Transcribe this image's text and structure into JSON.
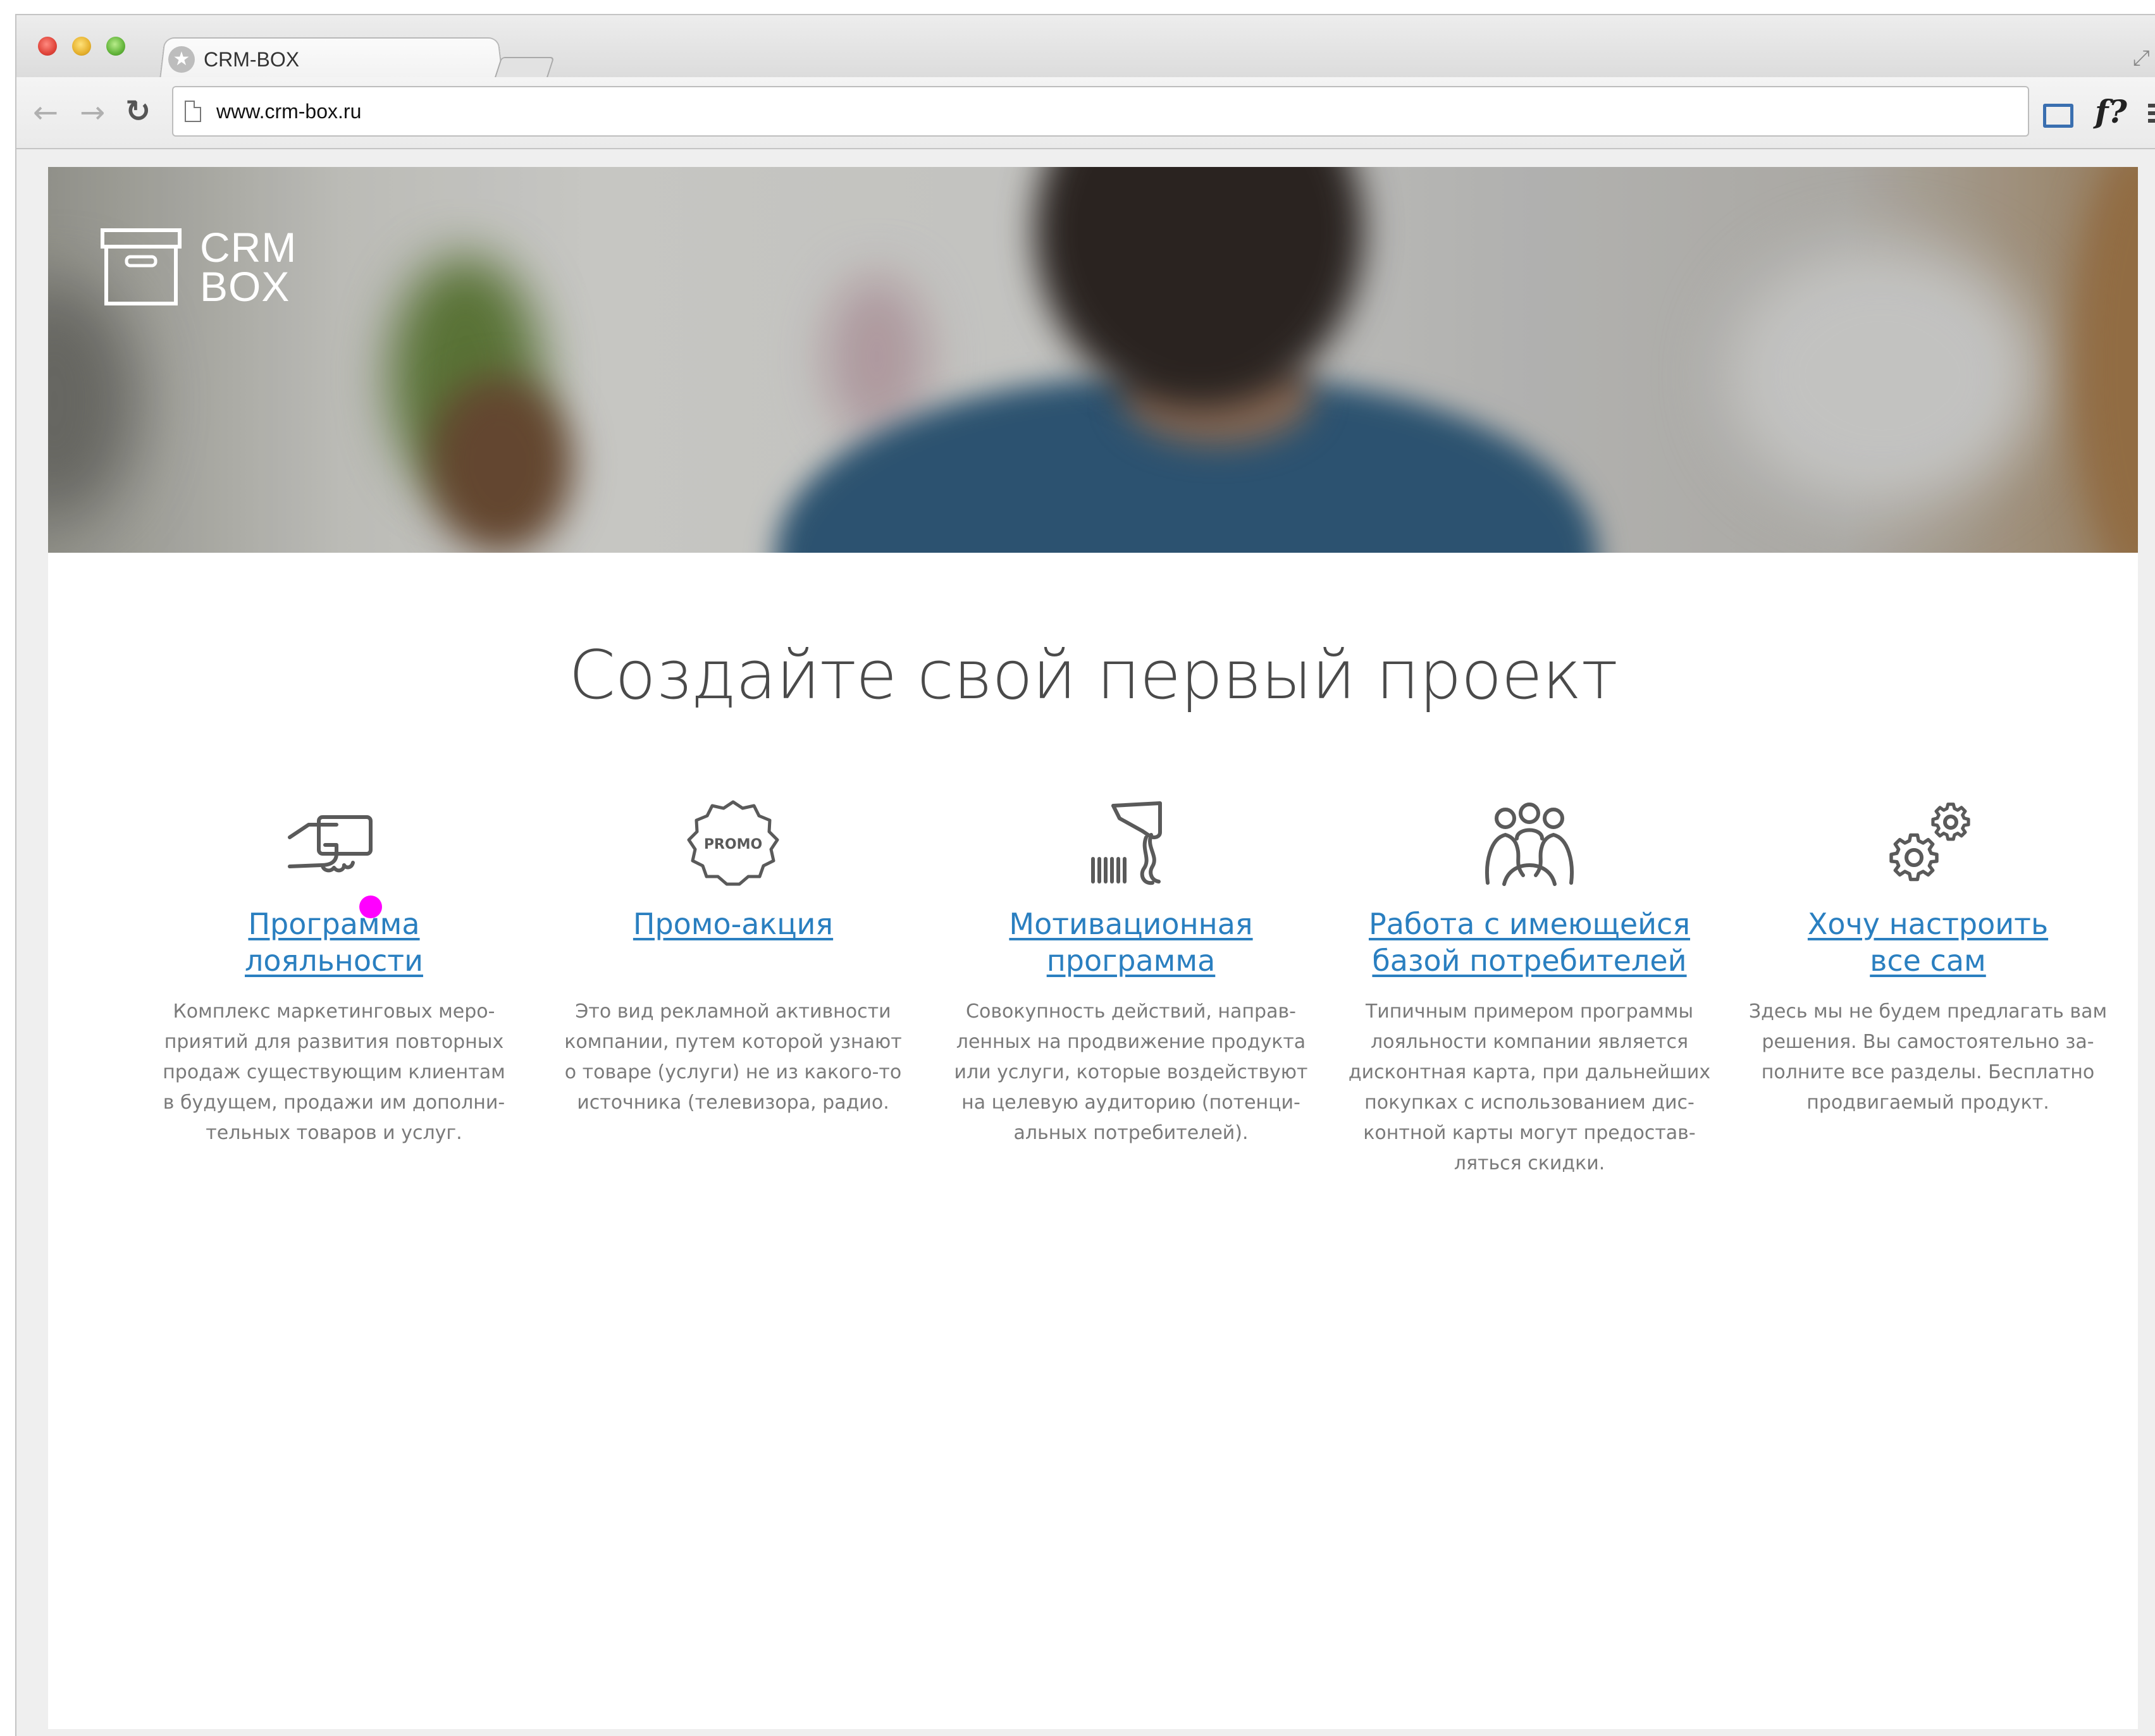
{
  "browser": {
    "tab_title": "CRM-BOX",
    "url": "www.crm-box.ru",
    "extension_label": "f?"
  },
  "logo": {
    "line1": "CRM",
    "line2": "BOX"
  },
  "headline": "Создайте свой первый проект",
  "promo_badge": "PROMO",
  "features": [
    {
      "icon": "card-in-hand-icon",
      "title_line1": "Программа",
      "title_line2": "лояльности",
      "desc": [
        "Комплекс маркетинговых меро-",
        "приятий для развития повторных",
        "продаж существующим клиентам",
        "в будущем, продажи им дополни-",
        "тельных товаров и услуг."
      ]
    },
    {
      "icon": "promo-badge-icon",
      "title_line1": "Промо-акция",
      "title_line2": "",
      "desc": [
        "Это вид рекламной активности",
        "компании, путем которой узнают",
        "о товаре (услуги) не из какого-то",
        "источника (телевизора, радио."
      ]
    },
    {
      "icon": "barcode-scanner-icon",
      "title_line1": "Мотивационная",
      "title_line2": "программа",
      "desc": [
        "Совокупность действий, направ-",
        "ленных на продвижение продукта",
        "или услуги, которые воздействуют",
        "на целевую аудиторию (потенци-",
        "альных потребителей)."
      ]
    },
    {
      "icon": "people-group-icon",
      "title_line1": "Работа с имеющейся",
      "title_line2": "базой потребителей",
      "desc": [
        "Типичным примером программы",
        "лояльности компании является",
        "дисконтная карта, при дальнейших",
        "покупках с использованием дис-",
        "контной карты могут предостав-",
        "ляться скидки."
      ]
    },
    {
      "icon": "gears-icon",
      "title_line1": "Хочу настроить",
      "title_line2": "все сам",
      "desc": [
        "Здесь мы не будем предлагать вам",
        "решения. Вы самостоятельно за-",
        "полните все разделы. Бесплатно",
        "продвигаемый продукт."
      ]
    }
  ],
  "colors": {
    "link": "#2a7fc0",
    "heading": "#4a4a4a",
    "body_text": "#7a7a7a",
    "icon_stroke": "#555555",
    "cursor_marker": "#ff00ff"
  }
}
